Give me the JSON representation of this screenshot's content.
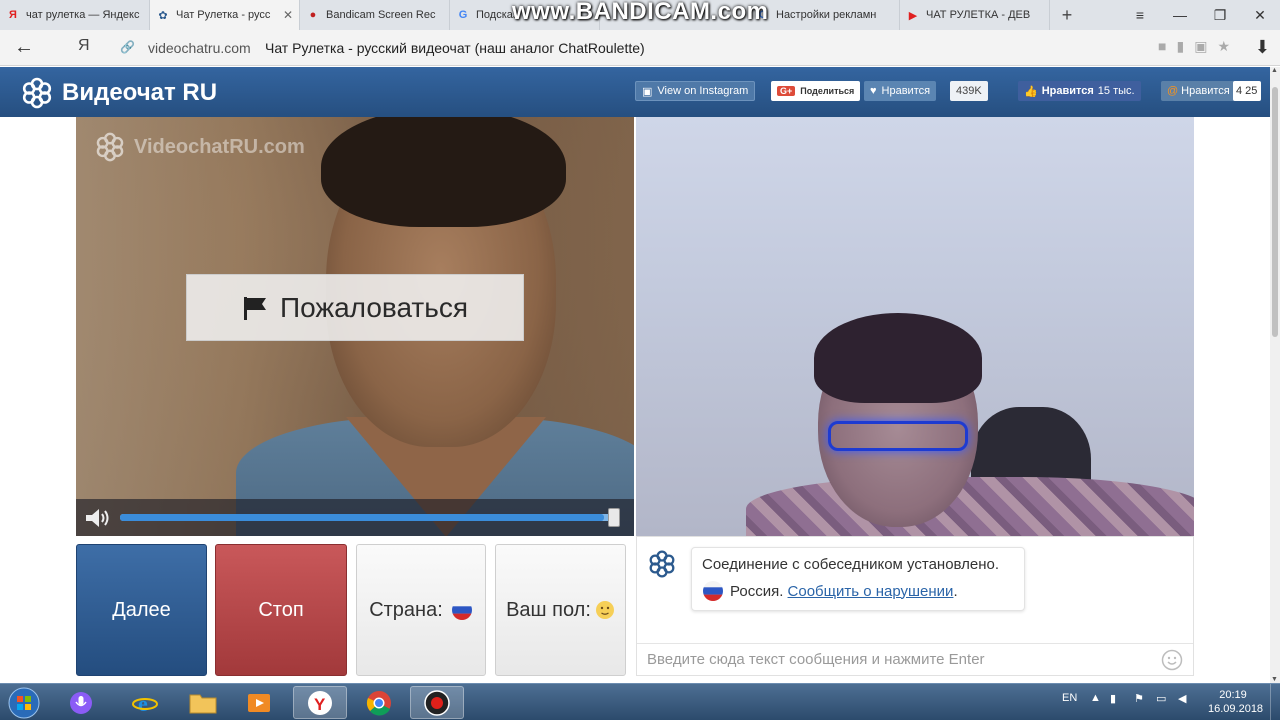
{
  "browser": {
    "tabs": [
      {
        "label": "чат рулетка — Яндекс",
        "favicon": "Я",
        "favicon_color": "#e02020",
        "active": false
      },
      {
        "label": "Чат Рулетка - русс",
        "favicon": "✿",
        "favicon_color": "#2c5a8e",
        "active": true
      },
      {
        "label": "Bandicam Screen Rec",
        "favicon": "●",
        "favicon_color": "#c02020",
        "active": false
      },
      {
        "label": "Подсказ",
        "favicon": "G",
        "favicon_color": "#4285f4",
        "active": false
      },
      {
        "label": "Настройки рекламн",
        "favicon": "G",
        "favicon_color": "#4285f4",
        "active": false
      },
      {
        "label": "ЧАТ РУЛЕТКА - ДЕВ",
        "favicon": "▶",
        "favicon_color": "#e02020",
        "active": false
      }
    ],
    "new_tab": "+",
    "window_controls": {
      "menu": "≡",
      "minimize": "—",
      "restore": "❐",
      "close": "✕"
    },
    "recorder_watermark": "www.BANDICAM.com",
    "back_glyph": "←",
    "yandex_glyph": "Я",
    "url_host": "videochatru.com",
    "page_title": "Чат Рулетка - русский видеочат (наш аналог ChatRoulette)",
    "download_glyph": "⬇"
  },
  "site": {
    "brand": "Видеочат RU",
    "social": {
      "instagram": "View on Instagram",
      "gplus": "Поделиться",
      "vk_like": "Нравится",
      "vk_count": "439K",
      "fb_like": "Нравится",
      "fb_count": "15 тыс.",
      "ok_like": "Нравится",
      "ok_count": "4 25"
    },
    "watermark": "VideochatRU.com",
    "complain": "Пожаловаться",
    "volume": 0.98,
    "controls": {
      "next": "Далее",
      "stop": "Стоп",
      "country": "Страна:",
      "gender": "Ваш пол:"
    },
    "chat": {
      "connected": "Соединение с собеседником установлено.",
      "country": "Россия.",
      "report_link": "Сообщить о нарушении",
      "report_tail": ".",
      "placeholder": "Введите сюда текст сообщения и нажмите Enter"
    }
  },
  "taskbar": {
    "lang": "EN",
    "time": "20:19",
    "date": "16.09.2018"
  },
  "colors": {
    "header": "#2c5a8e",
    "next": "#2f5d94",
    "stop": "#b44648",
    "link": "#2a64a8"
  }
}
